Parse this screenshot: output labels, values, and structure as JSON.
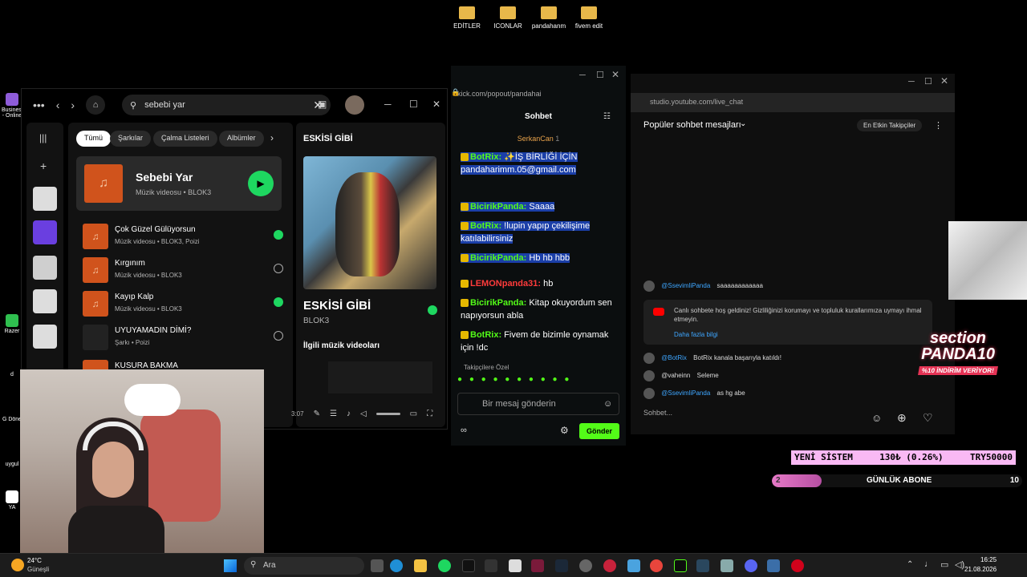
{
  "desktop": {
    "icons": [
      "EDİTLER",
      "ICONLAR",
      "pandahanm",
      "fivem edit"
    ],
    "side_labels": [
      "Business - Online",
      "Razer",
      "d",
      "G Döne",
      "uygul",
      "YA"
    ]
  },
  "spotify": {
    "search_value": "sebebi yar",
    "filters": [
      "Tümü",
      "Şarkılar",
      "Çalma Listeleri",
      "Albümler"
    ],
    "featured": {
      "title": "Sebebi Yar",
      "subtitle": "Müzik videosu • BLOK3"
    },
    "tracks": [
      {
        "title": "Çok Güzel Gülüyorsun",
        "subtitle": "Müzik videosu • BLOK3, Poizi",
        "saved": true
      },
      {
        "title": "Kırgınım",
        "subtitle": "Müzik videosu • BLOK3",
        "saved": false
      },
      {
        "title": "Kayıp Kalp",
        "subtitle": "Müzik videosu • BLOK3",
        "saved": true
      },
      {
        "title": "UYUYAMADIN DİMİ?",
        "subtitle": "Şarkı • Poizi",
        "saved": false
      },
      {
        "title": "KUSURA BAKMA",
        "subtitle": "",
        "saved": false
      }
    ],
    "now_playing": {
      "header": "ESKİSİ GİBİ",
      "title": "ESKİSİ GİBİ",
      "artist": "BLOK3",
      "related": "İlgili müzik videoları"
    },
    "time": "3:07"
  },
  "kick": {
    "url": "kick.com/popout/pandahai",
    "header": "Sohbet",
    "pinned_user": "SerkanCan",
    "pinned_count": "1",
    "messages": [
      {
        "user": "BotRix:",
        "text": "✨İŞ BİRLİĞİ İÇİN pandaharimm.05@gmail.com",
        "color": "#53fc18",
        "highlight": true
      },
      {
        "user": "BicirikPanda:",
        "text": "Saaaa",
        "color": "#53fc18",
        "highlight": true
      },
      {
        "user": "BotRix:",
        "text": "!lupin yapıp çekilişime katılabilirsiniz",
        "color": "#53fc18",
        "highlight": true
      },
      {
        "user": "BicirikPanda:",
        "text": "Hb hb hbb",
        "color": "#53fc18",
        "highlight": true
      },
      {
        "user": "LEMONpanda31:",
        "text": "hb",
        "color": "#ff3b3b",
        "highlight": false
      },
      {
        "user": "BicirikPanda:",
        "text": "Kitap okuyordum sen napıyorsun abla",
        "color": "#53fc18",
        "highlight": false
      },
      {
        "user": "BotRix:",
        "text": "Fivem de bizimle oynamak için !dc",
        "color": "#53fc18",
        "highlight": false
      }
    ],
    "followers_label": "Takipçilere Özel",
    "input_placeholder": "Bir mesaj gönderin",
    "send_label": "Gönder"
  },
  "youtube": {
    "url": "studio.youtube.com/live_chat",
    "title": "Popüler sohbet mesajları",
    "pill": "En Etkin Takipçiler",
    "messages": [
      {
        "user": "@SsevimliPanda",
        "text": "saaaaaaaaaaaa"
      },
      {
        "user": "@BotRix",
        "text": "BotRix kanala başarıyla katıldı!"
      },
      {
        "user": "@vaheinn",
        "text": "Seleme"
      },
      {
        "user": "@SsevimliPanda",
        "text": "as hg abe"
      }
    ],
    "notice": "Canlı sohbete hoş geldiniz! Gizliliğinizi korumayı ve topluluk kurallarımıza uymayı ihmal etmeyin.",
    "notice_link": "Daha fazla bilgi",
    "input_placeholder": "Sohbet..."
  },
  "overlay": {
    "logo_line1": "section",
    "logo_line2": "PANDA10",
    "logo_sub": "%10 İNDİRİM VERİYOR!",
    "goal": {
      "label": "YENİ SİSTEM",
      "amount": "130₺ (0.26%)",
      "target": "TRY50000"
    },
    "sub_goal": {
      "current": "2",
      "label": "GÜNLÜK ABONE",
      "target": "10",
      "progress": 0.2
    }
  },
  "taskbar": {
    "weather_temp": "24°C",
    "weather_desc": "Güneşli",
    "search_placeholder": "Ara",
    "time": "16:25",
    "date": "21.08.2026"
  }
}
